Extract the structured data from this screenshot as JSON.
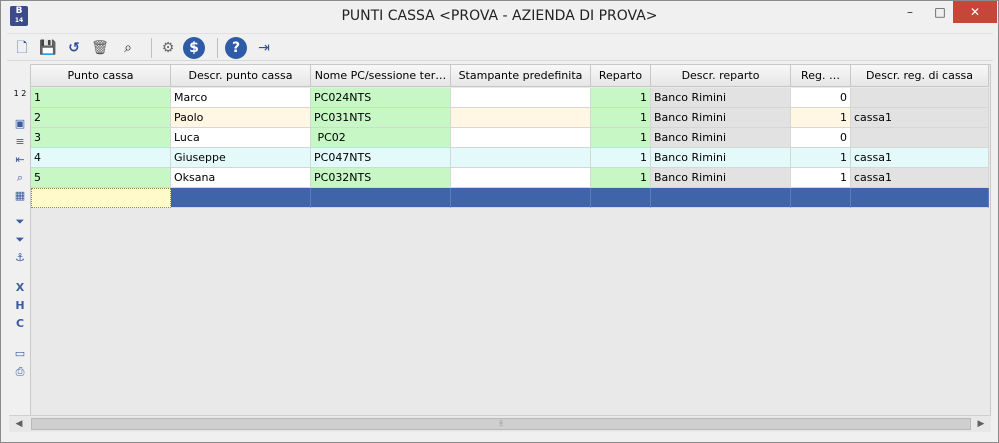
{
  "window": {
    "title": "PUNTI CASSA <PROVA - AZIENDA DI PROVA>",
    "app_icon": "B",
    "app_icon_sub": "14",
    "minimize": "–",
    "maximize": "□",
    "close": "✕"
  },
  "toolbar": {
    "buttons": [
      {
        "name": "new-document-icon",
        "glyph": "🗋"
      },
      {
        "name": "save-icon",
        "glyph": "💾"
      },
      {
        "name": "undo-icon",
        "glyph": "↺"
      },
      {
        "name": "trash-icon",
        "glyph": "🗑"
      },
      {
        "name": "binoculars-icon",
        "glyph": "⌕"
      },
      {
        "name": "gear-icon",
        "glyph": "⚙"
      },
      {
        "name": "dollar-icon",
        "glyph": "$"
      },
      {
        "name": "help-icon",
        "glyph": "?"
      },
      {
        "name": "exit-door-icon",
        "glyph": "⇥"
      }
    ]
  },
  "sidebar": {
    "items": [
      {
        "name": "row-height-icon",
        "glyph": "1 2"
      },
      {
        "name": "copy-icon",
        "glyph": "▣"
      },
      {
        "name": "list-icon",
        "glyph": "≡"
      },
      {
        "name": "import-icon",
        "glyph": "⇤"
      },
      {
        "name": "zoom-icon",
        "glyph": "⌕"
      },
      {
        "name": "calendar-icon",
        "glyph": "▦"
      },
      {
        "name": "filter-icon",
        "glyph": "⏷"
      },
      {
        "name": "filter-remove-icon",
        "glyph": "⏷"
      },
      {
        "name": "anchor-icon",
        "glyph": "⚓"
      },
      {
        "name": "export-excel-icon",
        "glyph": "X"
      },
      {
        "name": "export-html-icon",
        "glyph": "H"
      },
      {
        "name": "export-csv-icon",
        "glyph": "C"
      },
      {
        "name": "monitor-icon",
        "glyph": "▭"
      },
      {
        "name": "print-icon",
        "glyph": "⎙"
      }
    ]
  },
  "grid": {
    "columns": [
      "Punto cassa",
      "Descr. punto cassa",
      "Nome PC/sessione ter…",
      "Stampante predefinita",
      "Reparto",
      "Descr. reparto",
      "Reg. …",
      "Descr. reg. di cassa"
    ],
    "rows": [
      [
        "1",
        "Marco",
        "PC024NTS",
        "",
        "1",
        "Banco Rimini",
        "0",
        ""
      ],
      [
        "2",
        "Paolo",
        "PC031NTS",
        "",
        "1",
        "Banco Rimini",
        "1",
        "cassa1"
      ],
      [
        "3",
        "Luca",
        " PC02",
        "",
        "1",
        "Banco Rimini",
        "0",
        ""
      ],
      [
        "4",
        "Giuseppe",
        "PC047NTS",
        "",
        "1",
        "Banco Rimini",
        "1",
        "cassa1"
      ],
      [
        "5",
        "Oksana",
        "PC032NTS",
        "",
        "1",
        "Banco Rimini",
        "1",
        "cassa1"
      ]
    ]
  },
  "scrollbar": {
    "left_arrow": "◀",
    "right_arrow": "▶",
    "grip": "⦙⦙"
  }
}
